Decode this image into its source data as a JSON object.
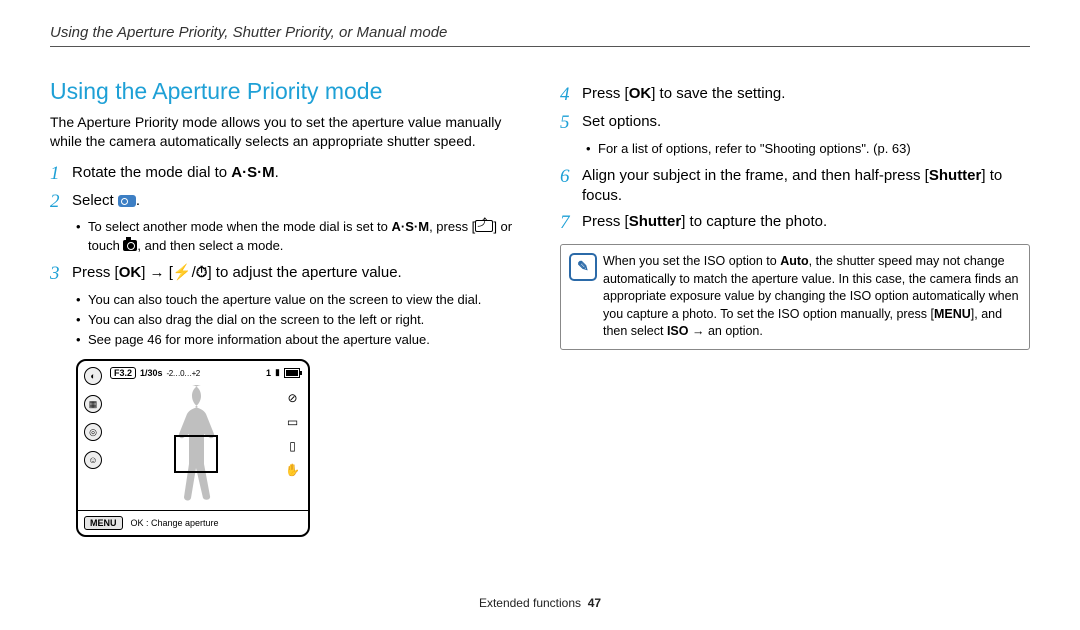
{
  "header": "Using the Aperture Priority, Shutter Priority, or Manual mode",
  "section_title": "Using the Aperture Priority mode",
  "lead": "The Aperture Priority mode allows you to set the aperture value manually while the camera automatically selects an appropriate shutter speed.",
  "glyphs": {
    "asm": "A·S·M",
    "ok": "OK",
    "menu": "MENU",
    "flash": "⚡",
    "timer": "⏱",
    "arrow": "→"
  },
  "left_steps": {
    "s1": {
      "n": "1",
      "pre": "Rotate the mode dial to ",
      "post": "."
    },
    "s2": {
      "n": "2",
      "pre": "Select ",
      "post": "."
    },
    "s2_sub": {
      "pre": "To select another mode when the mode dial is set to ",
      "mid": ", press [",
      "mid2": "] or touch ",
      "post": ", and then select a mode."
    },
    "s3": {
      "n": "3",
      "pre": "Press [",
      "mid1": "] ",
      "mid2": " [",
      "mid3": "/",
      "mid4": "] to adjust the aperture value."
    },
    "s3_sub1": "You can also touch the aperture value on the screen to view the dial.",
    "s3_sub2": "You can also drag the dial on the screen to the left or right.",
    "s3_sub3": "See page 46 for more information about the aperture value."
  },
  "lcd": {
    "f": "F3.2",
    "shutter": "1/30s",
    "ev": "-2…0…+2",
    "count": "1",
    "menu": "MENU",
    "hint": "OK : Change aperture"
  },
  "right_steps": {
    "s4": {
      "n": "4",
      "pre": "Press [",
      "post": "] to save the setting."
    },
    "s5": {
      "n": "5",
      "txt": "Set options."
    },
    "s5_sub": "For a list of options, refer to \"Shooting options\". (p. 63)",
    "s6": {
      "n": "6",
      "pre": "Align your subject in the frame, and then half-press [",
      "b": "Shutter",
      "post": "] to focus."
    },
    "s7": {
      "n": "7",
      "pre": "Press [",
      "b": "Shutter",
      "post": "] to capture the photo."
    }
  },
  "note": {
    "pre": "When you set the ISO option to ",
    "b1": "Auto",
    "mid": ", the shutter speed may not change automatically to match the aperture value. In this case, the camera finds an appropriate exposure value by changing the ISO option automatically when you capture a photo. To set the ISO option manually, press [",
    "b2": "MENU",
    "mid2": "], and then select ",
    "b3": "ISO",
    "arrow": " → ",
    "post": "an option."
  },
  "footer": {
    "section": "Extended functions",
    "page": "47"
  }
}
